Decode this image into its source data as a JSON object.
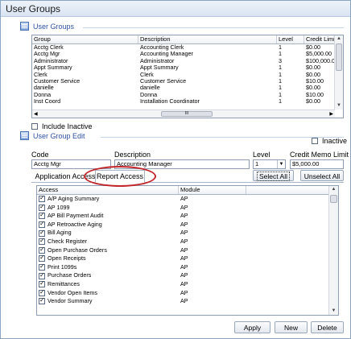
{
  "window": {
    "title": "User Groups"
  },
  "groups_section": {
    "title": "User Groups"
  },
  "groups_grid": {
    "columns": [
      "Group",
      "Description",
      "Level",
      "Credit Limit"
    ],
    "rows": [
      [
        "Acctg Clerk",
        "Accounting Clerk",
        "1",
        "$0.00"
      ],
      [
        "Acctg Mgr",
        "Accounting Manager",
        "1",
        "$5,000.00"
      ],
      [
        "Administrator",
        "Administrator",
        "3",
        "$100,000.0"
      ],
      [
        "Appt Summary",
        "Appt Summary",
        "1",
        "$0.00"
      ],
      [
        "Clerk",
        "Clerk",
        "1",
        "$0.00"
      ],
      [
        "Customer Service",
        "Customer Service",
        "1",
        "$10.00"
      ],
      [
        "danielle",
        "danielle",
        "1",
        "$0.00"
      ],
      [
        "Donna",
        "Donna",
        "1",
        "$10.00"
      ],
      [
        "Inst Coord",
        "Installation Coordinator",
        "1",
        "$0.00"
      ]
    ],
    "hscroll_glyph": "III"
  },
  "include_inactive": {
    "label": "Include Inactive",
    "checked": false
  },
  "edit_section": {
    "title": "User Group Edit"
  },
  "inactive": {
    "label": "Inactive",
    "checked": false
  },
  "form": {
    "code_label": "Code",
    "code_value": "Acctg Mgr",
    "description_label": "Description",
    "description_value": "Accounting Manager",
    "level_label": "Level",
    "level_value": "1",
    "credit_label": "Credit Memo Limit",
    "credit_value": "$5,000.00"
  },
  "tabs": [
    {
      "label": "Application Access",
      "selected": false
    },
    {
      "label": "Report Access",
      "selected": true
    }
  ],
  "buttons": {
    "select_all": "Select All",
    "unselect_all": "Unselect All",
    "apply": "Apply",
    "new": "New",
    "delete": "Delete"
  },
  "access_grid": {
    "columns": [
      "Access",
      "Module"
    ],
    "rows": [
      {
        "name": "A/P Aging Summary",
        "module": "AP",
        "checked": true
      },
      {
        "name": "AP 1099",
        "module": "AP",
        "checked": true
      },
      {
        "name": "AP Bill Payment Audit",
        "module": "AP",
        "checked": true
      },
      {
        "name": "AP Retroactive Aging",
        "module": "AP",
        "checked": true
      },
      {
        "name": "Bill Aging",
        "module": "AP",
        "checked": true
      },
      {
        "name": "Check Register",
        "module": "AP",
        "checked": true
      },
      {
        "name": "Open Purchase Orders",
        "module": "AP",
        "checked": true
      },
      {
        "name": "Open Receipts",
        "module": "AP",
        "checked": true
      },
      {
        "name": "Print 1099s",
        "module": "AP",
        "checked": true
      },
      {
        "name": "Purchase Orders",
        "module": "AP",
        "checked": true
      },
      {
        "name": "Remittances",
        "module": "AP",
        "checked": true
      },
      {
        "name": "Vendor Open Items",
        "module": "AP",
        "checked": true
      },
      {
        "name": "Vendor Summary",
        "module": "AP",
        "checked": true
      }
    ]
  },
  "colors": {
    "annotation": "#c1262b",
    "section_title": "#2f52a0"
  }
}
